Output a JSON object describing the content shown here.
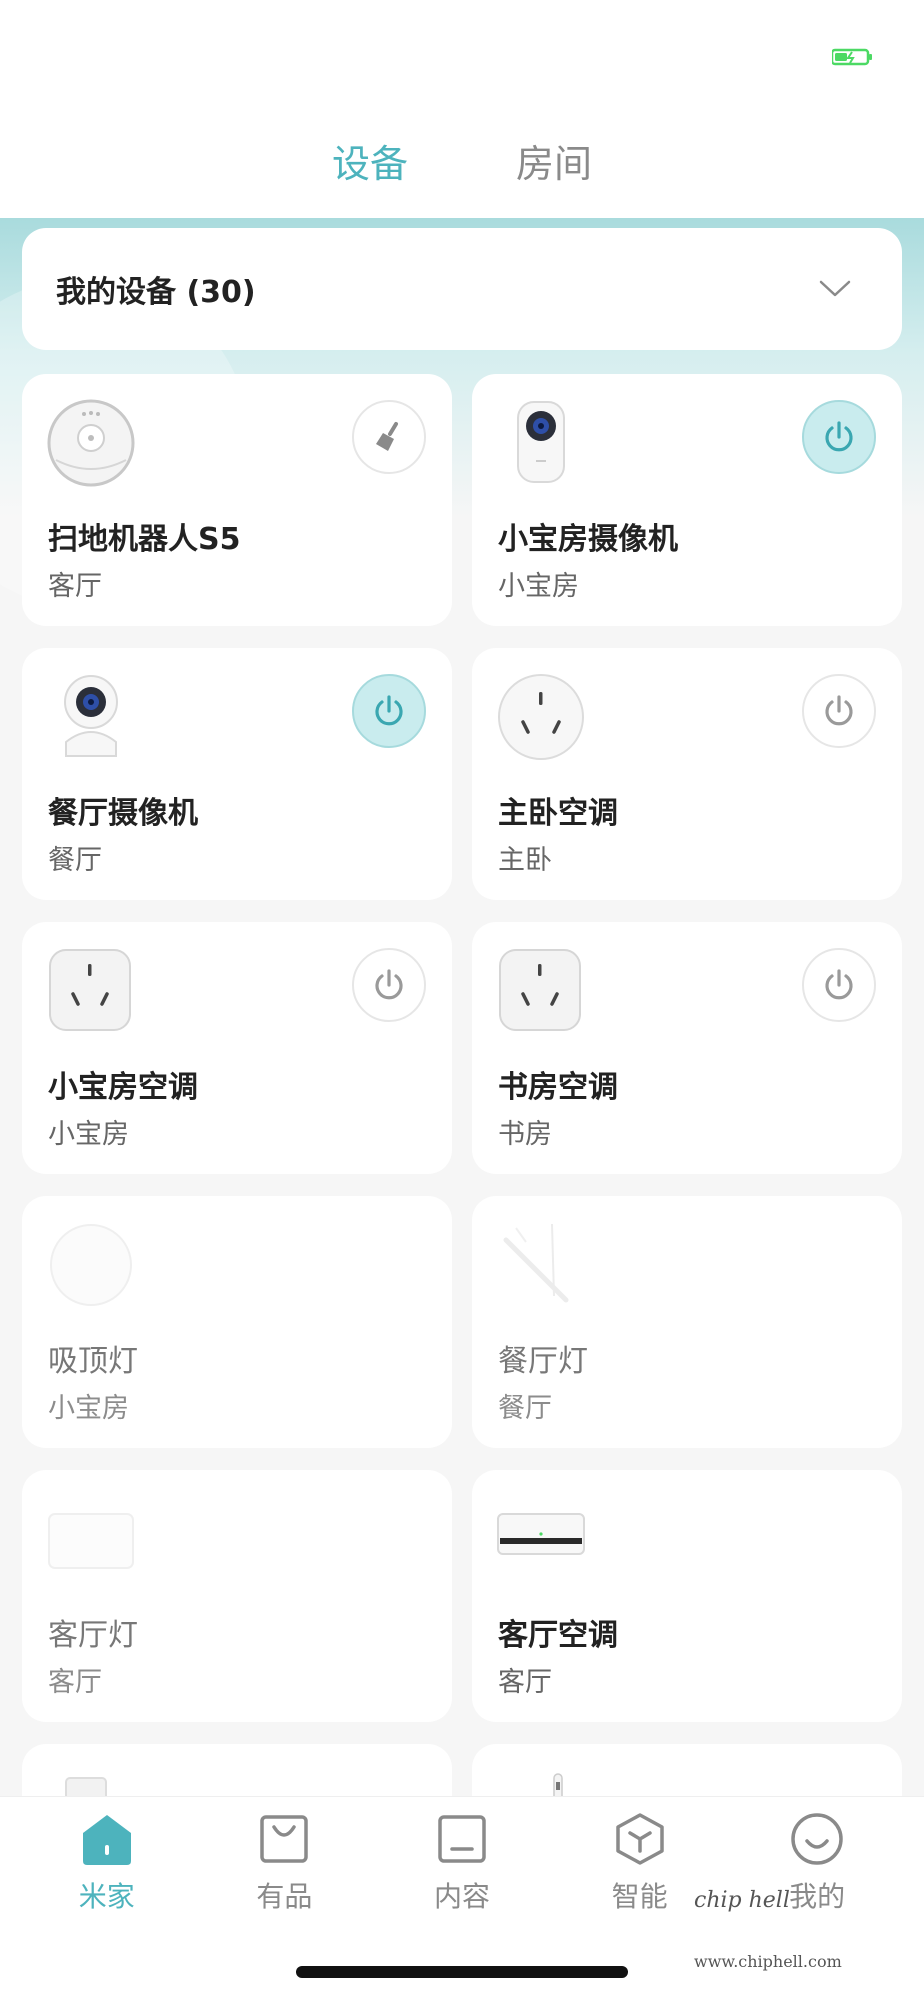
{
  "top_tabs": [
    {
      "label": "设备",
      "active": true
    },
    {
      "label": "房间",
      "active": false
    }
  ],
  "device_selector": {
    "title": "我的设备 (30)"
  },
  "devices": [
    {
      "name": "扫地机器人S5",
      "room": "客厅",
      "icon": "robot-vacuum-icon",
      "action": "broom-icon",
      "state": "off"
    },
    {
      "name": "小宝房摄像机",
      "room": "小宝房",
      "icon": "camera-icon",
      "action": "power-icon",
      "state": "on"
    },
    {
      "name": "餐厅摄像机",
      "room": "餐厅",
      "icon": "camera-icon",
      "action": "power-icon",
      "state": "on"
    },
    {
      "name": "主卧空调",
      "room": "主卧",
      "icon": "round-socket-icon",
      "action": "power-icon",
      "state": "off"
    },
    {
      "name": "小宝房空调",
      "room": "小宝房",
      "icon": "square-socket-icon",
      "action": "power-icon",
      "state": "off"
    },
    {
      "name": "书房空调",
      "room": "书房",
      "icon": "square-socket-icon",
      "action": "power-icon",
      "state": "off"
    },
    {
      "name": "吸顶灯",
      "room": "小宝房",
      "icon": "ceiling-light-icon",
      "action": "",
      "state": "offline"
    },
    {
      "name": "餐厅灯",
      "room": "餐厅",
      "icon": "pendant-light-icon",
      "action": "",
      "state": "offline"
    },
    {
      "name": "客厅灯",
      "room": "客厅",
      "icon": "panel-light-icon",
      "action": "",
      "state": "offline"
    },
    {
      "name": "客厅空调",
      "room": "客厅",
      "icon": "air-conditioner-icon",
      "action": "",
      "state": "online"
    }
  ],
  "bottom_nav": [
    {
      "label": "米家",
      "icon": "home-icon",
      "active": true
    },
    {
      "label": "有品",
      "icon": "shopping-bag-icon",
      "active": false
    },
    {
      "label": "内容",
      "icon": "content-icon",
      "active": false
    },
    {
      "label": "智能",
      "icon": "smart-cube-icon",
      "active": false
    },
    {
      "label": "我的",
      "icon": "smiley-icon",
      "active": false
    }
  ],
  "watermark": {
    "text": "chip hell",
    "url": "www.chiphell.com"
  },
  "colors": {
    "accent": "#4db3bd",
    "accent_soft": "#c9ecee",
    "battery": "#4cd964"
  }
}
